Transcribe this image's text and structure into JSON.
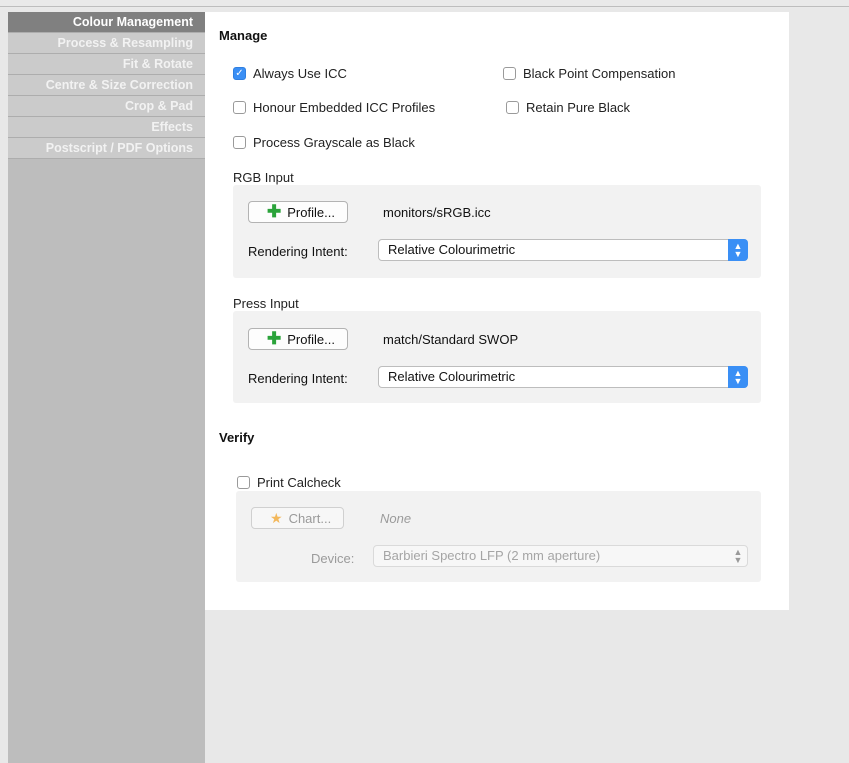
{
  "sidebar": {
    "items": [
      {
        "label": "Colour Management",
        "active": true
      },
      {
        "label": "Process & Resampling",
        "active": false
      },
      {
        "label": "Fit & Rotate",
        "active": false
      },
      {
        "label": "Centre & Size Correction",
        "active": false
      },
      {
        "label": "Crop & Pad",
        "active": false
      },
      {
        "label": "Effects",
        "active": false
      },
      {
        "label": "Postscript / PDF Options",
        "active": false
      }
    ]
  },
  "manage": {
    "title": "Manage",
    "always_use_icc": {
      "label": "Always Use ICC",
      "checked": true
    },
    "black_point_comp": {
      "label": "Black Point Compensation",
      "checked": false
    },
    "honour_embedded": {
      "label": "Honour Embedded ICC Profiles",
      "checked": false
    },
    "retain_pure_black": {
      "label": "Retain Pure Black",
      "checked": false
    },
    "process_grayscale": {
      "label": "Process Grayscale as Black",
      "checked": false
    }
  },
  "rgb_input": {
    "title": "RGB Input",
    "profile_button": "Profile...",
    "profile_value": "monitors/sRGB.icc",
    "intent_label": "Rendering Intent:",
    "intent_value": "Relative Colourimetric"
  },
  "press_input": {
    "title": "Press Input",
    "profile_button": "Profile...",
    "profile_value": "match/Standard SWOP",
    "intent_label": "Rendering Intent:",
    "intent_value": "Relative Colourimetric"
  },
  "verify": {
    "title": "Verify",
    "print_calcheck": {
      "label": "Print Calcheck",
      "checked": false
    },
    "chart_button": "Chart...",
    "chart_value": "None",
    "device_label": "Device:",
    "device_value": "Barbieri Spectro LFP (2 mm aperture)"
  },
  "colors": {
    "accent": "#3a8ff5",
    "plus_green": "#2aa33a",
    "sidebar_active": "#808080",
    "sidebar_bg": "#bdbdbd"
  }
}
